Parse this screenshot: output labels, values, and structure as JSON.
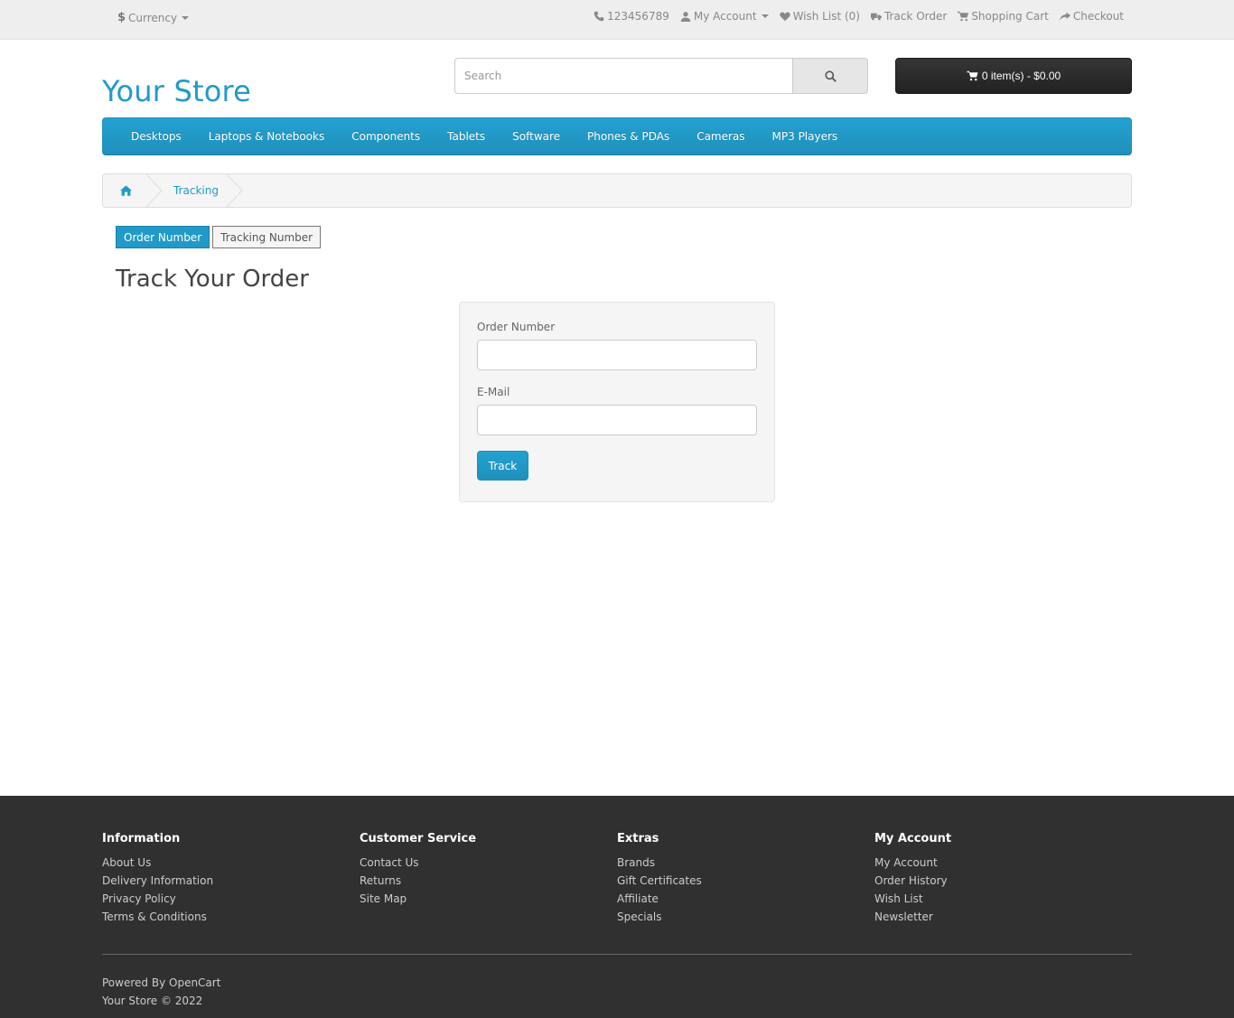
{
  "topbar": {
    "currency_symbol": "$",
    "currency_label": "Currency",
    "phone": "123456789",
    "my_account": "My Account",
    "wish_list": "Wish List (0)",
    "track_order": "Track Order",
    "shopping_cart": "Shopping Cart",
    "checkout": "Checkout"
  },
  "header": {
    "logo": "Your Store",
    "search_placeholder": "Search",
    "cart_label": "0 item(s) - $0.00"
  },
  "menu": {
    "items": [
      "Desktops",
      "Laptops & Notebooks",
      "Components",
      "Tablets",
      "Software",
      "Phones & PDAs",
      "Cameras",
      "MP3 Players"
    ]
  },
  "breadcrumb": {
    "current": "Tracking"
  },
  "tabs": {
    "order_number": "Order Number",
    "tracking_number": "Tracking Number"
  },
  "page": {
    "title": "Track Your Order"
  },
  "form": {
    "order_label": "Order Number",
    "email_label": "E-Mail",
    "submit": "Track"
  },
  "footer": {
    "information": {
      "title": "Information",
      "links": [
        "About Us",
        "Delivery Information",
        "Privacy Policy",
        "Terms & Conditions"
      ]
    },
    "customer_service": {
      "title": "Customer Service",
      "links": [
        "Contact Us",
        "Returns",
        "Site Map"
      ]
    },
    "extras": {
      "title": "Extras",
      "links": [
        "Brands",
        "Gift Certificates",
        "Affiliate",
        "Specials"
      ]
    },
    "my_account": {
      "title": "My Account",
      "links": [
        "My Account",
        "Order History",
        "Wish List",
        "Newsletter"
      ]
    },
    "powered_by": "Powered By",
    "opencart": "OpenCart",
    "copyright": "Your Store © 2022"
  },
  "colors": {
    "accent": "#229ac8",
    "footer_bg": "#303030",
    "cart_bg": "#2c2c2c"
  }
}
